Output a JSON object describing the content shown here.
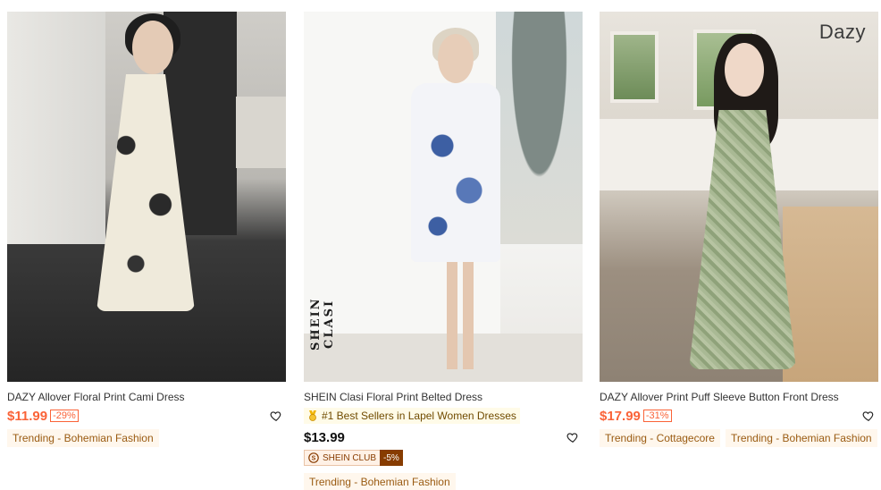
{
  "products": [
    {
      "brand_overlay": "",
      "title": "DAZY Allover Floral Print Cami Dress",
      "price": "$11.99",
      "discount": "-29%",
      "tags": [
        "Trending - Bohemian Fashion"
      ]
    },
    {
      "brand_overlay": "SHEIN CLASI",
      "title": "SHEIN Clasi Floral Print Belted Dress",
      "bestseller": "#1 Best Sellers in Lapel Women Dresses",
      "price": "$13.99",
      "club_label": "SHEIN CLUB",
      "club_discount": "-5%",
      "tags": [
        "Trending - Bohemian Fashion"
      ]
    },
    {
      "brand_overlay": "Dazy",
      "title": "DAZY Allover Print Puff Sleeve Button Front Dress",
      "price": "$17.99",
      "discount": "-31%",
      "tags": [
        "Trending - Cottagecore",
        "Trending - Bohemian Fashion"
      ]
    }
  ],
  "colors": {
    "sale_price": "#fa6338",
    "tag_bg": "#fff7ed",
    "tag_text": "#9a5b12",
    "club_dark": "#873c00"
  },
  "icons": {
    "wishlist": "heart-outline-icon",
    "bestseller": "medal-icon",
    "club": "shein-club-icon"
  }
}
